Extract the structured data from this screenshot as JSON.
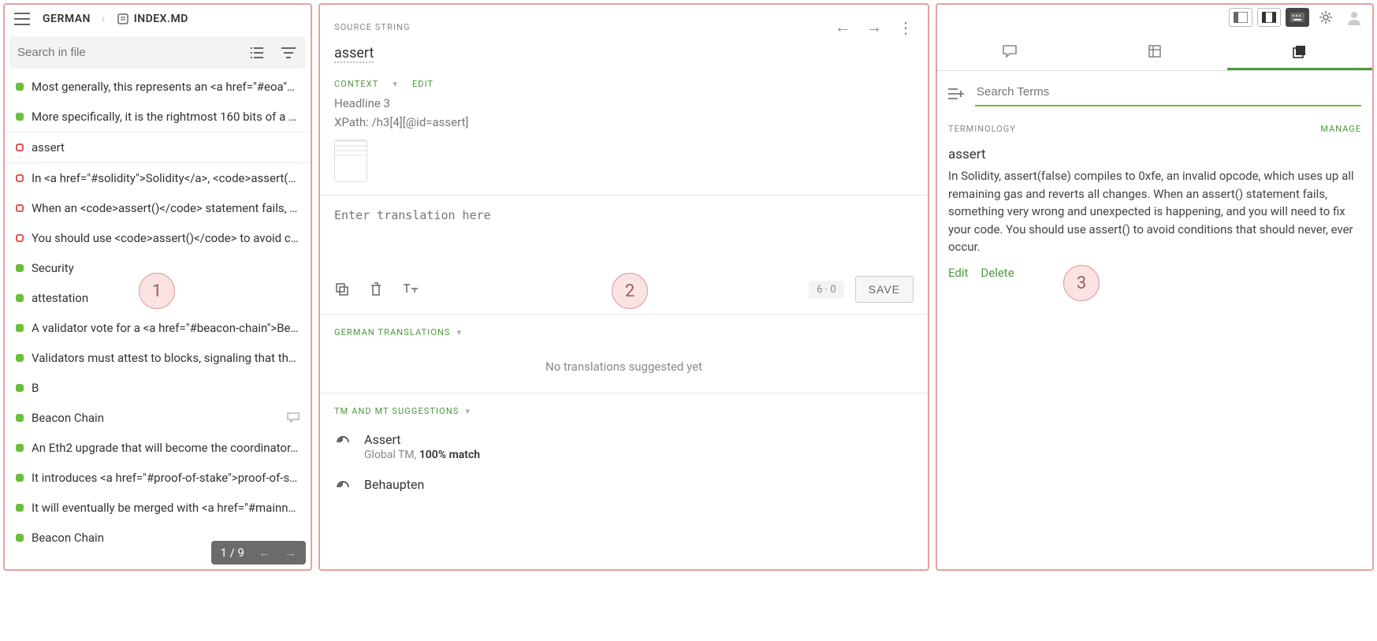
{
  "panel1": {
    "breadcrumb": {
      "lang": "GERMAN",
      "file": "INDEX.MD"
    },
    "search_placeholder": "Search in file",
    "items": [
      {
        "dot": "green",
        "text": "Most generally, this represents an <a href=\"#eoa\"…"
      },
      {
        "dot": "green",
        "text": "More specifically, it is the rightmost 160 bits of a …"
      },
      {
        "dot": "red",
        "text": "assert",
        "active": true
      },
      {
        "dot": "red",
        "text": "In <a href=\"#solidity\">Solidity</a>, <code>assert(…"
      },
      {
        "dot": "red",
        "text": "When an <code>assert()</code> statement fails, …"
      },
      {
        "dot": "red",
        "text": "You should use <code>assert()</code> to avoid c…"
      },
      {
        "dot": "green",
        "text": "Security"
      },
      {
        "dot": "green",
        "text": "attestation"
      },
      {
        "dot": "green",
        "text": "A validator vote for a <a href=\"#beacon-chain\">Be…"
      },
      {
        "dot": "green",
        "text": "Validators must attest to blocks, signaling that th…"
      },
      {
        "dot": "green",
        "text": "B"
      },
      {
        "dot": "green",
        "text": "Beacon Chain",
        "comment": true
      },
      {
        "dot": "green",
        "text": "An Eth2 upgrade that will become the coordinator…"
      },
      {
        "dot": "green",
        "text": "It introduces <a href=\"#proof-of-stake\">proof-of-s…"
      },
      {
        "dot": "green",
        "text": "It will eventually be merged with <a href=\"#mainn…"
      },
      {
        "dot": "green",
        "text": "Beacon Chain"
      }
    ],
    "pager": "1 / 9"
  },
  "panel2": {
    "source_label": "SOURCE STRING",
    "source_value": "assert",
    "context_label": "CONTEXT",
    "edit_label": "EDIT",
    "context_line1": "Headline 3",
    "context_line2": "XPath: /h3[4][@id=assert]",
    "translation_placeholder": "Enter translation here",
    "counter": "6 · 0",
    "save_label": "SAVE",
    "translations_header": "GERMAN TRANSLATIONS",
    "no_translations": "No translations suggested yet",
    "suggestions_header": "TM AND MT SUGGESTIONS",
    "suggestions": [
      {
        "title": "Assert",
        "sub_plain": "Global TM, ",
        "sub_bold": "100% match"
      },
      {
        "title": "Behaupten",
        "sub_plain": "",
        "sub_bold": ""
      }
    ]
  },
  "panel3": {
    "search_placeholder": "Search Terms",
    "terminology_label": "TERMINOLOGY",
    "manage_label": "MANAGE",
    "term_title": "assert",
    "term_desc": "In Solidity, assert(false) compiles to 0xfe, an invalid opcode, which uses up all remaining gas and reverts all changes. When an assert() statement fails, something very wrong and unexpected is happening, and you will need to fix your code. You should use assert() to avoid conditions that should never, ever occur.",
    "edit_label": "Edit",
    "delete_label": "Delete"
  },
  "badges": {
    "b1": "1",
    "b2": "2",
    "b3": "3"
  }
}
